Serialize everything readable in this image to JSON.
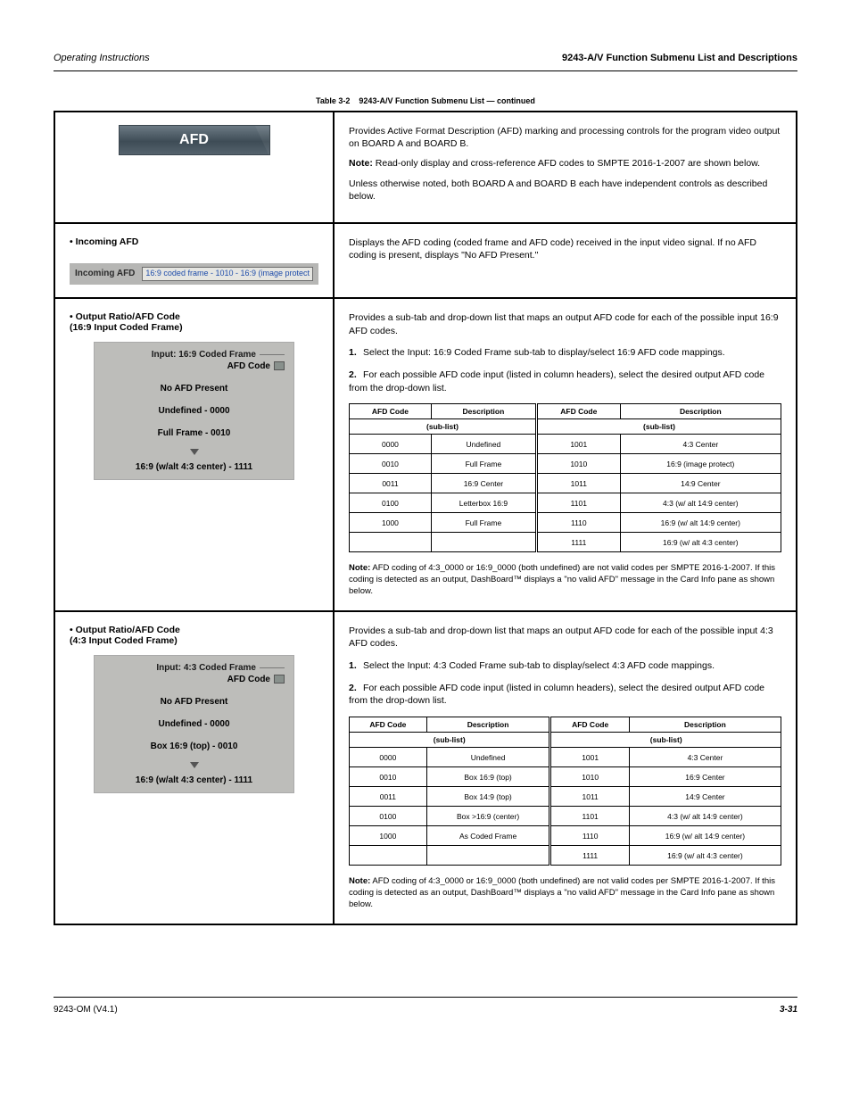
{
  "header": {
    "left": "Operating Instructions",
    "right": "9243-A/V Function Submenu List and Descriptions"
  },
  "footer": {
    "left": "9243-OM (V4.1)",
    "right": "3-31"
  },
  "table_caption": {
    "label": "Table 3-2",
    "title": "9243-A/V Function Submenu List — continued"
  },
  "tab": {
    "label": "AFD"
  },
  "panel_desc": {
    "p1": "Provides Active Format Description (AFD) marking and processing controls for the program video output on BOARD A and BOARD B.",
    "p2_prefix": "Note:",
    "p2": " Read-only display and cross-reference AFD codes to SMPTE 2016-1-2007 are shown below.",
    "p3": "Unless otherwise noted, both BOARD A and BOARD B each have independent controls as described below."
  },
  "incoming": {
    "title": "Incoming AFD",
    "label": "Incoming AFD",
    "value": "16:9 coded frame - 1010 - 16:9 (image protect",
    "desc": "Displays the AFD coding (coded frame and AFD code) received in the input video signal. If no AFD coding is present, displays \"No AFD Present.\""
  },
  "map169": {
    "title": "Output Ratio/AFD Code",
    "subtitle": "(16:9 Input Coded Frame)",
    "dropdown": {
      "header": "Input: 16:9 Coded Frame",
      "label": "AFD Code",
      "items": [
        "No AFD Present",
        "Undefined - 0000",
        "Full Frame - 0010"
      ],
      "ellipsis_last": "16:9 (w/alt 4:3 center) - 1111"
    },
    "desc_lead": "Provides a sub-tab and drop-down list that maps an output AFD code for each of the possible input 16:9 AFD codes.",
    "step1": "Select the Input: 16:9 Coded Frame sub-tab to display/select 16:9 AFD code mappings.",
    "step2": "For each possible AFD code input (listed in column headers), select the desired output AFD code from the drop-down list.",
    "inner": {
      "sublist": "(sub-list)",
      "headers": [
        "AFD Code",
        "Description",
        "AFD Code",
        "Description"
      ],
      "rows": [
        [
          "0000",
          "Undefined",
          "1001",
          "4:3 Center"
        ],
        [
          "0010",
          "Full Frame",
          "1010",
          "16:9 (image protect)"
        ],
        [
          "0011",
          "16:9 Center",
          "1011",
          "14:9 Center"
        ],
        [
          "0100",
          "Letterbox 16:9",
          "1101",
          "4:3 (w/ alt 14:9 center)"
        ],
        [
          "1000",
          "Full Frame",
          "1110",
          "16:9 (w/ alt 14:9 center)"
        ],
        [
          "",
          "",
          "1111",
          "16:9 (w/ alt 4:3 center)"
        ]
      ]
    },
    "note_label": "Note:",
    "note": " AFD coding of 4:3_0000 or 16:9_0000 (both undefined) are not valid codes per SMPTE 2016-1-2007. If this coding is detected as an output, DashBoard™ displays a \"no valid AFD\" message in the Card Info pane as shown below."
  },
  "map43": {
    "title": "Output Ratio/AFD Code",
    "subtitle": "(4:3 Input Coded Frame)",
    "dropdown": {
      "header": "Input: 4:3 Coded Frame",
      "label": "AFD Code",
      "items": [
        "No AFD Present",
        "Undefined - 0000",
        "Box 16:9 (top) - 0010"
      ],
      "ellipsis_last": "16:9 (w/alt 4:3 center) - 1111"
    },
    "desc_lead": "Provides a sub-tab and drop-down list that maps an output AFD code for each of the possible input 4:3 AFD codes.",
    "step1": "Select the Input: 4:3 Coded Frame sub-tab to display/select 4:3 AFD code mappings.",
    "step2": "For each possible AFD code input (listed in column headers), select the desired output AFD code from the drop-down list.",
    "inner": {
      "sublist": "(sub-list)",
      "headers": [
        "AFD Code",
        "Description",
        "AFD Code",
        "Description"
      ],
      "rows": [
        [
          "0000",
          "Undefined",
          "1001",
          "4:3 Center"
        ],
        [
          "0010",
          "Box 16:9 (top)",
          "1010",
          "16:9 Center"
        ],
        [
          "0011",
          "Box 14:9 (top)",
          "1011",
          "14:9 Center"
        ],
        [
          "0100",
          "Box >16:9 (center)",
          "1101",
          "4:3 (w/ alt 14:9 center)"
        ],
        [
          "1000",
          "As Coded Frame",
          "1110",
          "16:9 (w/ alt 14:9 center)"
        ],
        [
          "",
          "",
          "1111",
          "16:9 (w/ alt 4:3 center)"
        ]
      ]
    },
    "note_label": "Note:",
    "note": " AFD coding of 4:3_0000 or 16:9_0000 (both undefined) are not valid codes per SMPTE 2016-1-2007. If this coding is detected as an output, DashBoard™ displays a \"no valid AFD\" message in the Card Info pane as shown below."
  }
}
